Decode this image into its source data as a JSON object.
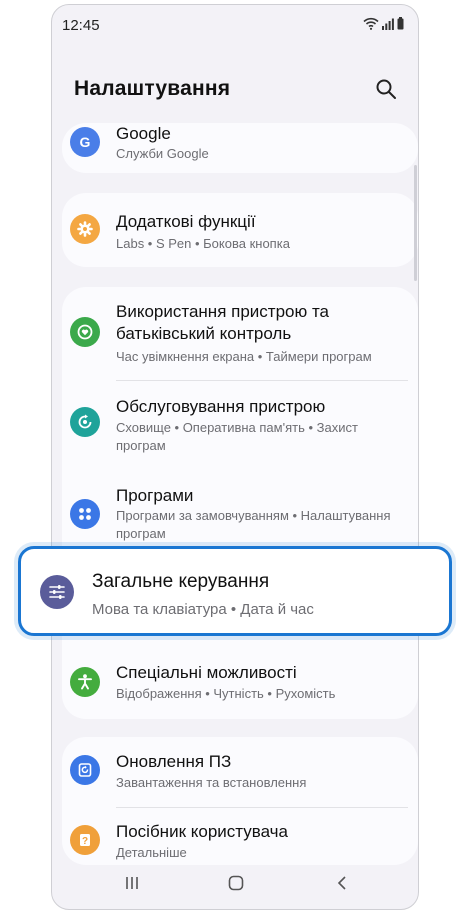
{
  "status": {
    "time": "12:45"
  },
  "header": {
    "title": "Налаштування"
  },
  "items": {
    "google": {
      "title": "Google",
      "sub": "Служби Google"
    },
    "extra": {
      "title": "Додаткові функції",
      "sub": "Labs  •  S Pen  •  Бокова кнопка"
    },
    "usage": {
      "title": "Використання пристрою та батьківський контроль",
      "sub": "Час увімкнення екрана  •  Таймери програм"
    },
    "care": {
      "title": "Обслуговування пристрою",
      "sub": "Сховище  •  Оперативна пам'ять  •  Захист програм"
    },
    "apps": {
      "title": "Програми",
      "sub": "Програми за замовчуванням  •  Налаштування програм"
    },
    "general": {
      "title": "Загальне керування",
      "sub": "Мова та клавіатура  •  Дата й час"
    },
    "access": {
      "title": "Спеціальні можливості",
      "sub": "Відображення  •  Чутність  •  Рухомість"
    },
    "update": {
      "title": "Оновлення ПЗ",
      "sub": "Завантаження та встановлення"
    },
    "manual": {
      "title": "Посібник користувача",
      "sub": "Детальніше"
    }
  },
  "icons": {
    "google": "google-icon",
    "extra": "gear-icon",
    "usage": "heart-icon",
    "care": "refresh-icon",
    "apps": "apps-grid-icon",
    "general": "sliders-icon",
    "access": "accessibility-icon",
    "update": "update-icon",
    "manual": "help-book-icon"
  },
  "colors": {
    "google": "#4a7ee8",
    "extra": "#f4a742",
    "usage": "#3ba94b",
    "care": "#1fa39a",
    "apps": "#3b77e6",
    "general": "#5a5c9a",
    "access": "#44ac3e",
    "update": "#3b77e6",
    "manual": "#f0a03a",
    "highlight_border": "#1a76d2"
  }
}
